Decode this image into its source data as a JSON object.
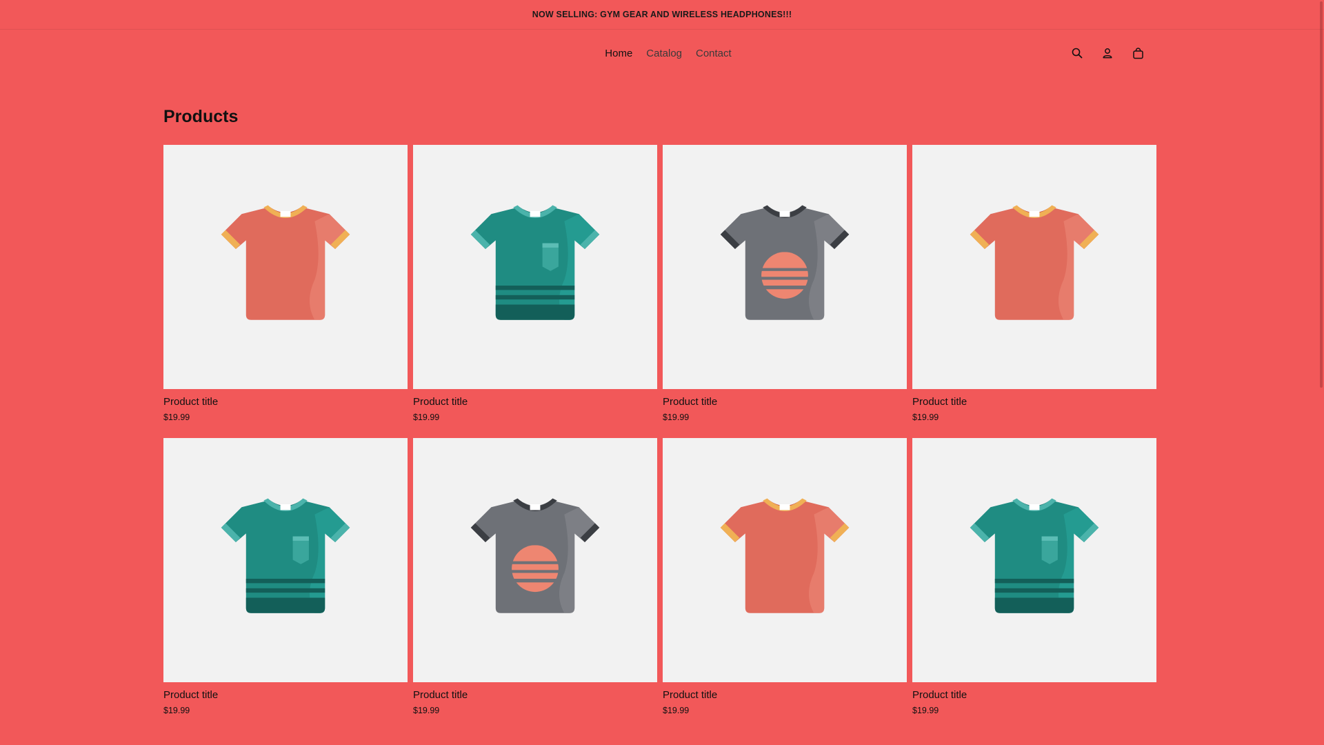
{
  "announcement": "NOW SELLING: GYM GEAR AND WIRELESS HEADPHONES!!!",
  "nav": [
    "Home",
    "Catalog",
    "Contact"
  ],
  "icons": [
    "search-icon",
    "account-icon",
    "cart-icon"
  ],
  "section_title": "Products",
  "colors": {
    "page_bg": "#f25859",
    "card_bg": "#f2f2f2"
  },
  "products": [
    {
      "title": "Product title",
      "price": "$19.99",
      "variant": "coral"
    },
    {
      "title": "Product title",
      "price": "$19.99",
      "variant": "teal"
    },
    {
      "title": "Product title",
      "price": "$19.99",
      "variant": "gray"
    },
    {
      "title": "Product title",
      "price": "$19.99",
      "variant": "coral"
    },
    {
      "title": "Product title",
      "price": "$19.99",
      "variant": "teal"
    },
    {
      "title": "Product title",
      "price": "$19.99",
      "variant": "gray"
    },
    {
      "title": "Product title",
      "price": "$19.99",
      "variant": "coral"
    },
    {
      "title": "Product title",
      "price": "$19.99",
      "variant": "teal"
    }
  ]
}
